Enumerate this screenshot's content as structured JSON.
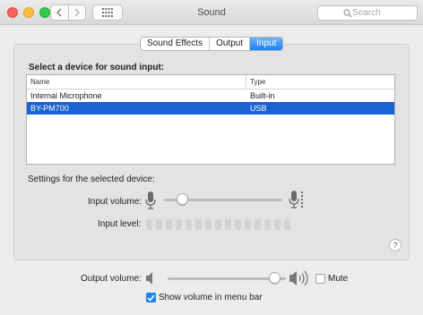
{
  "window": {
    "title": "Sound"
  },
  "toolbar": {
    "search_placeholder": "Search"
  },
  "tabs": [
    {
      "label": "Sound Effects",
      "active": false
    },
    {
      "label": "Output",
      "active": false
    },
    {
      "label": "Input",
      "active": true
    }
  ],
  "input": {
    "heading": "Select a device for sound input:",
    "columns": [
      "Name",
      "Type"
    ],
    "devices": [
      {
        "name": "Internal Microphone",
        "type": "Built-in",
        "selected": false
      },
      {
        "name": "BY-PM700",
        "type": "USB",
        "selected": true
      }
    ],
    "settings_label": "Settings for the selected device:",
    "input_volume_label": "Input volume:",
    "input_volume_fraction": 0.12,
    "input_level_label": "Input level:",
    "input_level_segments": 15
  },
  "output": {
    "volume_label": "Output volume:",
    "volume_fraction": 0.95,
    "mute_label": "Mute",
    "mute_checked": false,
    "show_volume_label": "Show volume in menu bar",
    "show_volume_checked": true
  },
  "help": {
    "glyph": "?"
  },
  "colors": {
    "accent": "#1a82f6",
    "selection": "#1962cf"
  }
}
